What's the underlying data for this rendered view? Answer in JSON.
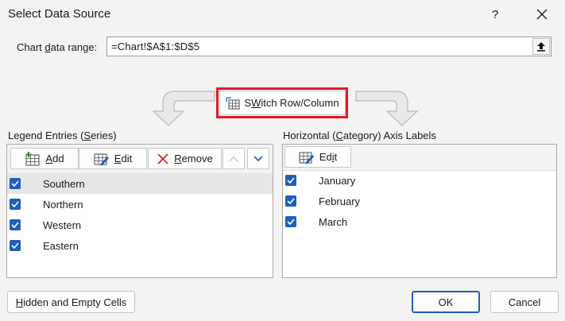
{
  "window": {
    "title": "Select Data Source",
    "help": "?",
    "close": "✕"
  },
  "range": {
    "label_pre": "Chart ",
    "label_u": "d",
    "label_post": "ata range:",
    "value": "=Chart!$A$1:$D$5"
  },
  "switch": {
    "label_u": "W",
    "label_pre": "S",
    "label_post": "itch Row/Column"
  },
  "legend": {
    "title_pre": "Legend Entries (",
    "title_u": "S",
    "title_post": "eries)",
    "add_u": "A",
    "add_post": "dd",
    "edit_u": "E",
    "edit_post": "dit",
    "remove_u": "R",
    "remove_post": "emove",
    "items": [
      {
        "label": "Southern",
        "checked": true
      },
      {
        "label": "Northern",
        "checked": true
      },
      {
        "label": "Western",
        "checked": true
      },
      {
        "label": "Eastern",
        "checked": true
      }
    ]
  },
  "axis": {
    "title_pre": "Horizontal (",
    "title_u": "C",
    "title_post": "ategory) Axis Labels",
    "edit_pre": "Ed",
    "edit_u": "i",
    "edit_post": "t",
    "items": [
      {
        "label": "January",
        "checked": true
      },
      {
        "label": "February",
        "checked": true
      },
      {
        "label": "March",
        "checked": true
      }
    ]
  },
  "footer": {
    "hidden_u": "H",
    "hidden_post": "idden and Empty Cells",
    "ok": "OK",
    "cancel": "Cancel"
  },
  "colors": {
    "accent": "#1f5fb8",
    "highlight": "#e01b24"
  }
}
